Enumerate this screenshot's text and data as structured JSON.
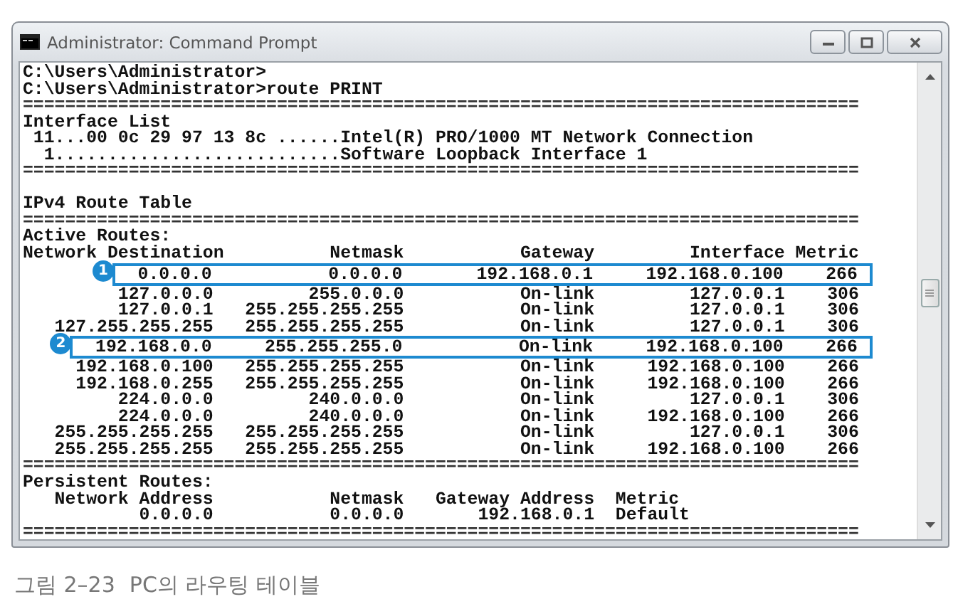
{
  "window": {
    "title": "Administrator: Command Prompt"
  },
  "console": [
    {
      "kind": "text",
      "text": "C:\\Users\\Administrator>"
    },
    {
      "kind": "text",
      "text": "C:\\Users\\Administrator>route PRINT"
    },
    {
      "kind": "rule",
      "text": "==============================================================================="
    },
    {
      "kind": "text",
      "text": "Interface List"
    },
    {
      "kind": "text",
      "text": " 11...00 0c 29 97 13 8c ......Intel(R) PRO/1000 MT Network Connection"
    },
    {
      "kind": "text",
      "text": "  1...........................Software Loopback Interface 1"
    },
    {
      "kind": "rule",
      "text": "==============================================================================="
    },
    {
      "kind": "blank"
    },
    {
      "kind": "text",
      "text": "IPv4 Route Table"
    },
    {
      "kind": "rule",
      "text": "==============================================================================="
    },
    {
      "kind": "text",
      "text": "Active Routes:"
    },
    {
      "kind": "route_header",
      "columns": [
        "Network Destination",
        "Netmask",
        "Gateway",
        "Interface",
        "Metric"
      ]
    },
    {
      "kind": "route",
      "cells": [
        "0.0.0.0",
        "0.0.0.0",
        "192.168.0.1",
        "192.168.0.100",
        "266"
      ],
      "highlighted": true,
      "marker": "1"
    },
    {
      "kind": "route",
      "cells": [
        "127.0.0.0",
        "255.0.0.0",
        "On-link",
        "127.0.0.1",
        "306"
      ],
      "highlighted": false
    },
    {
      "kind": "route",
      "cells": [
        "127.0.0.1",
        "255.255.255.255",
        "On-link",
        "127.0.0.1",
        "306"
      ],
      "highlighted": false
    },
    {
      "kind": "route",
      "cells": [
        "127.255.255.255",
        "255.255.255.255",
        "On-link",
        "127.0.0.1",
        "306"
      ],
      "highlighted": false
    },
    {
      "kind": "route",
      "cells": [
        "192.168.0.0",
        "255.255.255.0",
        "On-link",
        "192.168.0.100",
        "266"
      ],
      "highlighted": true,
      "marker": "2"
    },
    {
      "kind": "route",
      "cells": [
        "192.168.0.100",
        "255.255.255.255",
        "On-link",
        "192.168.0.100",
        "266"
      ],
      "highlighted": false
    },
    {
      "kind": "route",
      "cells": [
        "192.168.0.255",
        "255.255.255.255",
        "On-link",
        "192.168.0.100",
        "266"
      ],
      "highlighted": false
    },
    {
      "kind": "route",
      "cells": [
        "224.0.0.0",
        "240.0.0.0",
        "On-link",
        "127.0.0.1",
        "306"
      ],
      "highlighted": false
    },
    {
      "kind": "route",
      "cells": [
        "224.0.0.0",
        "240.0.0.0",
        "On-link",
        "192.168.0.100",
        "266"
      ],
      "highlighted": false
    },
    {
      "kind": "route",
      "cells": [
        "255.255.255.255",
        "255.255.255.255",
        "On-link",
        "127.0.0.1",
        "306"
      ],
      "highlighted": false
    },
    {
      "kind": "route",
      "cells": [
        "255.255.255.255",
        "255.255.255.255",
        "On-link",
        "192.168.0.100",
        "266"
      ],
      "highlighted": false
    },
    {
      "kind": "rule",
      "text": "==============================================================================="
    },
    {
      "kind": "text",
      "text": "Persistent Routes:"
    },
    {
      "kind": "persistent",
      "cells": [
        "Network Address",
        "Netmask",
        "Gateway Address",
        "Metric"
      ]
    },
    {
      "kind": "persistent",
      "cells": [
        "0.0.0.0",
        "0.0.0.0",
        "192.168.0.1",
        "Default"
      ]
    },
    {
      "kind": "rule",
      "text": "==============================================================================="
    }
  ],
  "caption": {
    "number": "그림 2–23",
    "title": "PC의 라우팅 테이블"
  }
}
